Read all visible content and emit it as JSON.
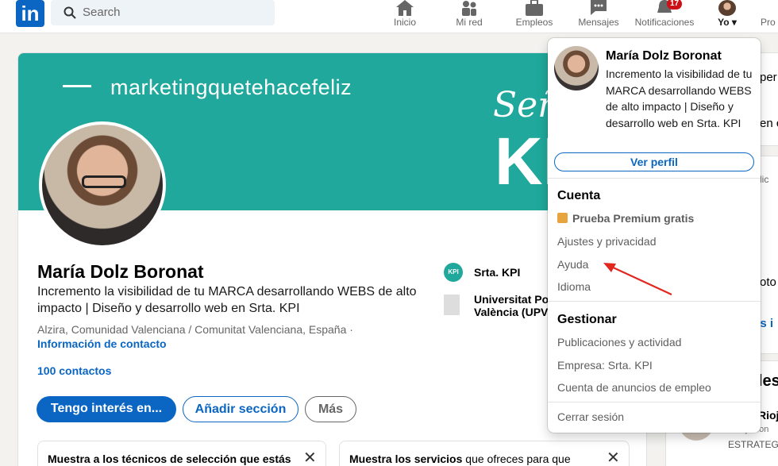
{
  "header": {
    "logo_text": "in",
    "search_placeholder": "Search",
    "nav": [
      {
        "label": "Inicio",
        "icon": "home-icon"
      },
      {
        "label": "Mi red",
        "icon": "network-icon"
      },
      {
        "label": "Empleos",
        "icon": "briefcase-icon"
      },
      {
        "label": "Mensajes",
        "icon": "messaging-icon"
      },
      {
        "label": "Notificaciones",
        "icon": "bell-icon",
        "badge": "17"
      },
      {
        "label": "Yo",
        "icon": "avatar"
      },
      {
        "label": "Pro",
        "icon": "premium-icon"
      }
    ]
  },
  "profile": {
    "banner_brand": "marketingquetehacefeliz",
    "banner_sen": "Seño",
    "banner_kpi": "KP",
    "name": "María Dolz Boronat",
    "headline": "Incremento la visibilidad de tu MARCA desarrollando WEBS de alto impacto | Diseño y desarrollo web en Srta. KPI",
    "location": "Alzira, Comunidad Valenciana / Comunitat Valenciana, España ·",
    "contact_info": "Información de contacto",
    "connections": "100 contactos",
    "buttons": {
      "primary": "Tengo interés en...",
      "secondary": "Añadir sección",
      "more": "Más"
    },
    "experience": [
      {
        "label": "Srta. KPI",
        "logo_text": "KPI"
      },
      {
        "label": "Universitat Po",
        "line2": "València (UPV"
      }
    ],
    "suggestions": [
      {
        "text": "Muestra a los técnicos de selección que estás"
      },
      {
        "text_bold": "Muestra los servicios",
        "text_rest": " que ofreces para que"
      }
    ]
  },
  "right_column": {
    "frag1": "per",
    "frag2": "en c",
    "frag3": "lic",
    "frag4": "oto",
    "frag5": "ás i",
    "frag6": "les",
    "frag7": "Rioj",
    "frag8": "rabajo con",
    "frag9": "ESTRATEGI"
  },
  "dropdown": {
    "name": "María Dolz Boronat",
    "headline": "Incremento la visibilidad de tu MARCA desarrollando WEBS de alto impacto | Diseño y desarrollo web en Srta. KPI",
    "view_profile": "Ver perfil",
    "account_title": "Cuenta",
    "premium": "Prueba Premium gratis",
    "settings": "Ajustes y privacidad",
    "help": "Ayuda",
    "language": "Idioma",
    "manage_title": "Gestionar",
    "posts": "Publicaciones y actividad",
    "company": "Empresa: Srta. KPI",
    "job_ads": "Cuenta de anuncios de empleo",
    "sign_out": "Cerrar sesión"
  },
  "colors": {
    "brand_blue": "#0a66c2",
    "banner_teal": "#1fa89b",
    "annotation_red": "#e0281f",
    "premium_gold": "#e7a33e"
  }
}
